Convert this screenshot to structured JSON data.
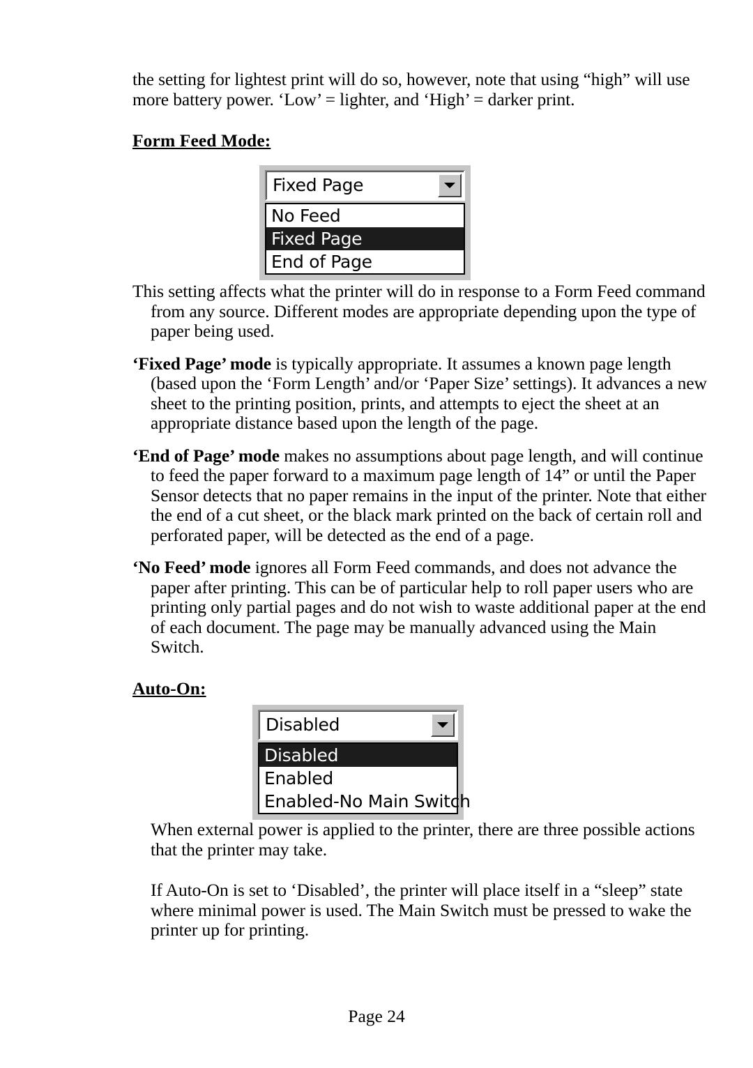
{
  "document": {
    "paragraphs": {
      "intro": "the setting for lightest print will do so, however, note that using “high” will use more battery power.  ‘Low’ = lighter, and ‘High’ = darker print.",
      "form_feed_intro": "This setting affects what the printer will do in response to a Form Feed command from any source.  Different modes are appropriate depending upon the type of paper being used.",
      "fixed_page_lead": "‘Fixed Page’ mode",
      "fixed_page_rest": " is typically appropriate.  It assumes a known page length (based upon the ‘Form Length’ and/or ‘Paper Size’ settings).  It advances a new sheet to the printing position, prints, and attempts to eject the sheet at an appropriate distance based upon the length of the page.",
      "end_of_page_lead": "‘End of Page’ mode",
      "end_of_page_rest": " makes no assumptions about page length, and will continue to feed the paper forward to a maximum page length of 14” or until the Paper Sensor detects that no paper remains in the input of the printer.  Note that either the end of a cut sheet, or the black mark printed on the back of certain roll and perforated paper, will be detected as the end of a page.",
      "no_feed_lead": "‘No Feed’ mode",
      "no_feed_rest": " ignores all Form Feed commands, and does not advance the paper after printing.  This can be of particular help to roll paper users who are printing only partial pages and do not wish to waste additional paper at the end of each document.  The page may be manually advanced using the Main Switch.",
      "auto_on_intro": "When external power is applied to the printer, there are three possible actions that the printer may take.",
      "auto_on_disabled": "If Auto-On is set to ‘Disabled’, the printer will place itself in a “sleep” state where minimal power is used.  The Main Switch must be pressed to wake the printer up for printing."
    },
    "headings": {
      "form_feed_mode": "Form Feed Mode:",
      "auto_on": "Auto-On:"
    },
    "footer": {
      "page_label": "Page 24"
    }
  },
  "widgets": {
    "form_feed_combo": {
      "selected_value": "Fixed Page",
      "arrow_icon": "chevron-down-icon",
      "options": [
        {
          "label": "No Feed",
          "selected": false
        },
        {
          "label": "Fixed Page",
          "selected": true
        },
        {
          "label": "End of Page",
          "selected": false
        }
      ]
    },
    "auto_on_combo": {
      "selected_value": "Disabled",
      "arrow_icon": "chevron-down-icon",
      "options": [
        {
          "label": "Disabled",
          "selected": true
        },
        {
          "label": "Enabled",
          "selected": false
        },
        {
          "label": "Enabled-No Main Switch",
          "selected": false
        }
      ]
    }
  },
  "colors": {
    "page_background": "#ffffff",
    "text": "#000000",
    "widget_face": "#c6c6c6",
    "widget_field": "#ffffff",
    "widget_highlight": "#1c1c1c",
    "widget_highlight_text": "#ffffff",
    "widget_border_dark": "#3f3f3f",
    "widget_border_light": "#ffffff"
  }
}
